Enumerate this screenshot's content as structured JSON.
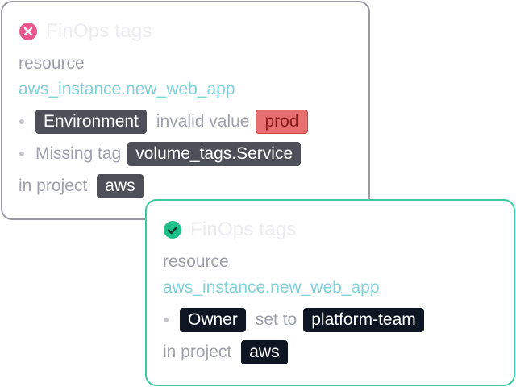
{
  "cards": [
    {
      "status": "error",
      "status_icon": "x-circle-icon",
      "status_color": "#e8578f",
      "title": "FinOps tags",
      "resource_label": "resource",
      "resource_name": "aws_instance.new_web_app",
      "issues": [
        {
          "tag": "Environment",
          "text": "invalid value",
          "value": "prod"
        },
        {
          "text": "Missing tag",
          "tag": "volume_tags.Service"
        }
      ],
      "project_label": "in project",
      "project": "aws"
    },
    {
      "status": "success",
      "status_icon": "check-circle-icon",
      "status_color": "#1fbf8a",
      "title": "FinOps tags",
      "resource_label": "resource",
      "resource_name": "aws_instance.new_web_app",
      "changes": [
        {
          "tag": "Owner",
          "text": "set to",
          "value": "platform-team"
        }
      ],
      "project_label": "in project",
      "project": "aws"
    }
  ]
}
